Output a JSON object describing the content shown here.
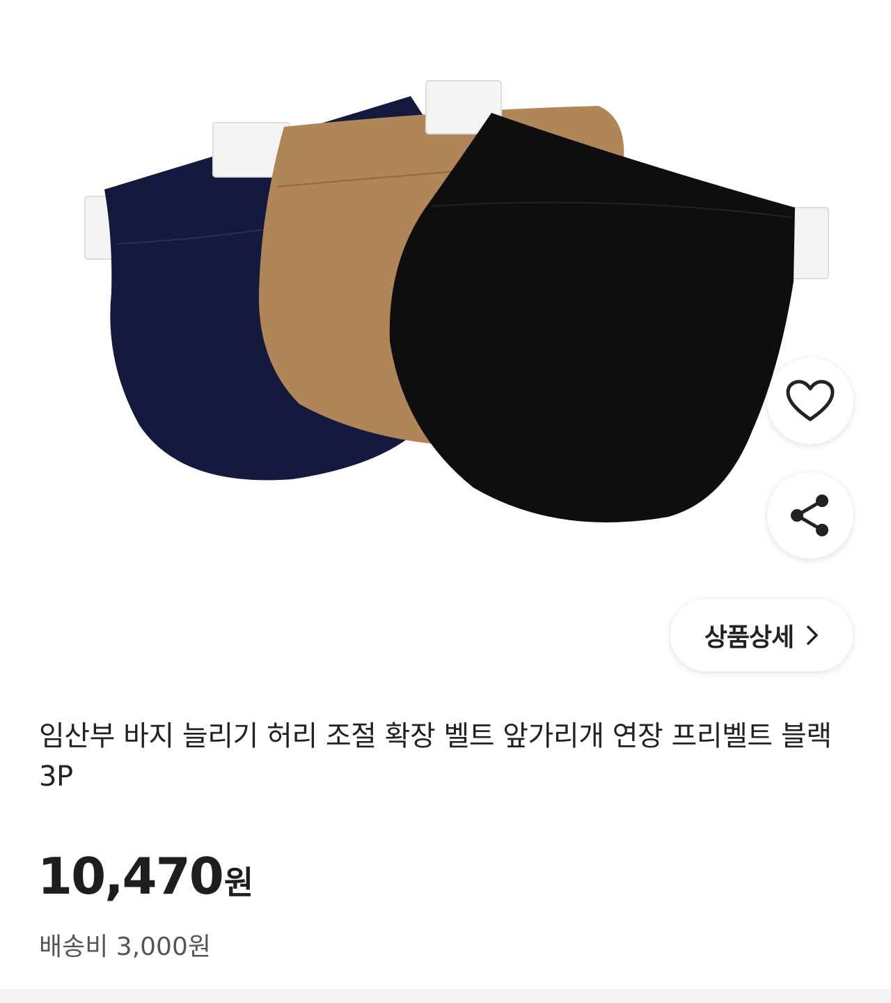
{
  "product": {
    "title": "임산부 바지 늘리기 허리 조절 확장 벨트 앞가리개 연장 프리벨트 블랙 3P",
    "price_value": "10,470",
    "price_unit": "원",
    "shipping_label": "배송비 3,000원",
    "image_items": [
      "navy",
      "brown",
      "black"
    ]
  },
  "actions": {
    "like_icon": "heart-icon",
    "share_icon": "share-icon",
    "detail_label": "상품상세",
    "detail_icon": "chevron-right-icon"
  },
  "colors": {
    "navy": "#131a3e",
    "brown": "#b08658",
    "black": "#0e0e10",
    "tab_white": "#f4f4f4"
  }
}
